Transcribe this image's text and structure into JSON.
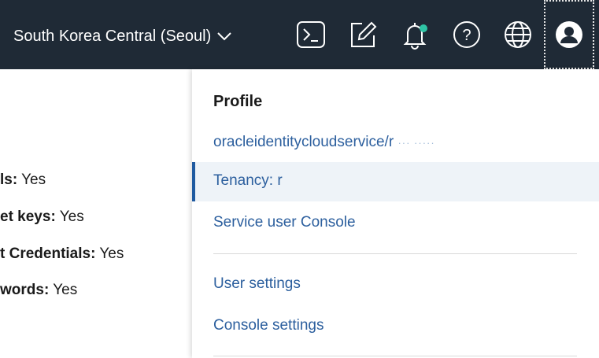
{
  "header": {
    "region_label": "South Korea Central (Seoul)",
    "icons": [
      {
        "name": "cloud-shell-icon"
      },
      {
        "name": "edit-icon"
      },
      {
        "name": "notification-bell-icon",
        "badge_color": "#2ec4a5"
      },
      {
        "name": "help-icon",
        "glyph": "?"
      },
      {
        "name": "language-globe-icon"
      },
      {
        "name": "profile-avatar-icon"
      }
    ]
  },
  "background": {
    "rows": [
      {
        "label": "ls:",
        "value": "Yes"
      },
      {
        "label": "et keys:",
        "value": "Yes"
      },
      {
        "label": "t Credentials:",
        "value": "Yes"
      },
      {
        "label": "words:",
        "value": "Yes"
      }
    ]
  },
  "profile_menu": {
    "title": "Profile",
    "username": "oracleidentitycloudservice/r",
    "tenancy_label": "Tenancy: r",
    "service_console": "Service user Console",
    "user_settings": "User settings",
    "console_settings": "Console settings"
  },
  "colors": {
    "header_bg": "#1f2a36",
    "link": "#2c5f9e",
    "active_row_bg": "#eef3f8",
    "active_row_accent": "#1f5aa0"
  }
}
